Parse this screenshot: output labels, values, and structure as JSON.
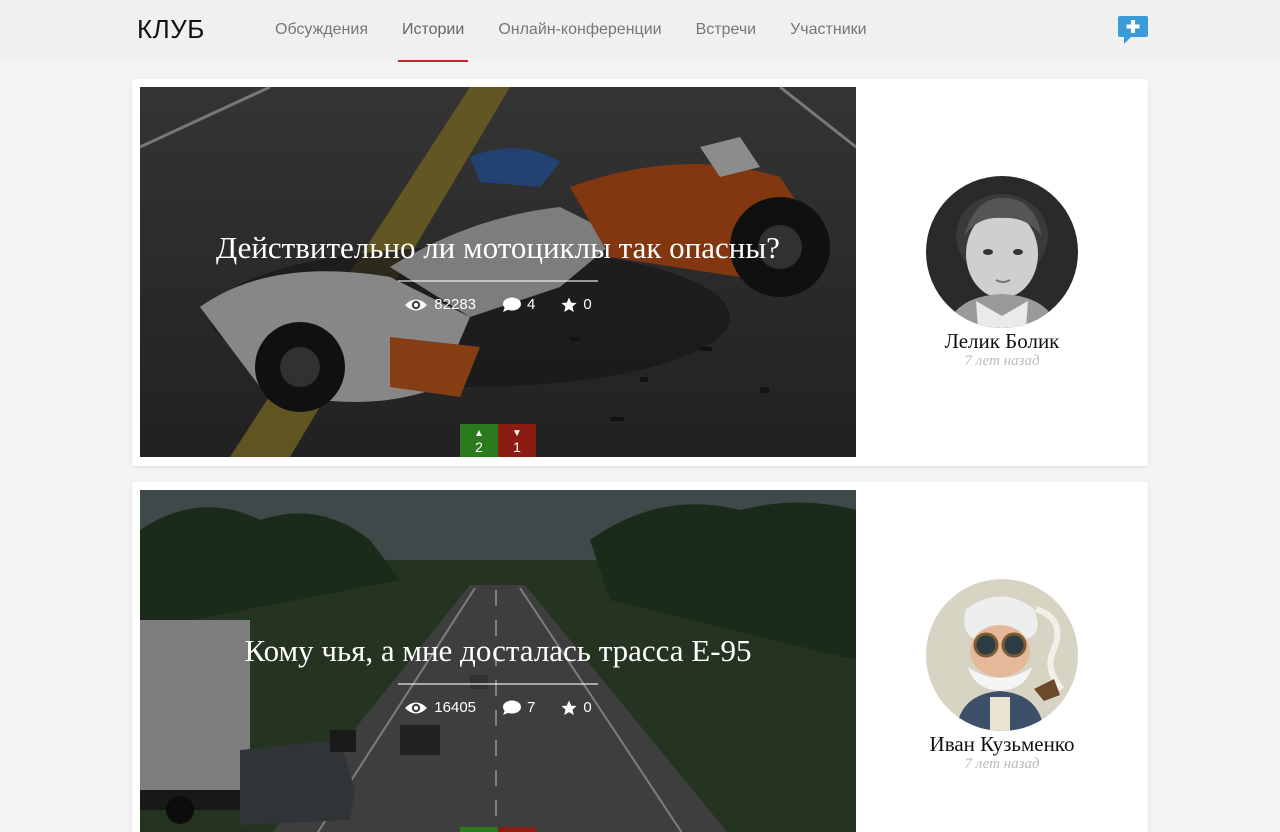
{
  "brand": "КЛУБ",
  "nav": [
    {
      "label": "Обсуждения"
    },
    {
      "label": "Истории"
    },
    {
      "label": "Онлайн-конференции"
    },
    {
      "label": "Встречи"
    },
    {
      "label": "Участники"
    }
  ],
  "active_tab": "Истории",
  "colors": {
    "accent": "#d0202e",
    "add_icon": "#3a9bd9",
    "vote_up": "#2b7a1d",
    "vote_down": "#8b1c14"
  },
  "stories": [
    {
      "title": "Действительно ли мотоциклы так опасны?",
      "views": "82283",
      "comments": "4",
      "favorites": "0",
      "votes_up": "2",
      "votes_down": "1",
      "author": "Лелик Болик",
      "time": "7 лет назад"
    },
    {
      "title": "Кому чья, а мне досталась трасса Е-95",
      "views": "16405",
      "comments": "7",
      "favorites": "0",
      "author": "Иван Кузьменко",
      "time": "7 лет назад"
    }
  ]
}
